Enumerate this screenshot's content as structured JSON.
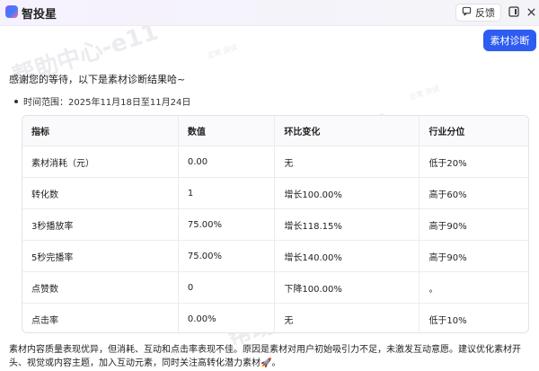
{
  "app": {
    "title": "智投星"
  },
  "header": {
    "feedback_label": "反馈"
  },
  "action": {
    "diagnose_label": "素材诊断"
  },
  "message": {
    "intro": "感谢您的等待，以下是素材诊断结果哈~",
    "time_range": "时间范围：2025年11月18日至11月24日",
    "summary": "素材内容质量表现优异，但消耗、互动和点击率表现不佳。原因是素材对用户初始吸引力不足，未激发互动意愿。建议优化素材开头、视觉或内容主题，加入互动元素，同时关注高转化潜力素材🚀。"
  },
  "table": {
    "headers": [
      "指标",
      "数值",
      "环比变化",
      "行业分位"
    ],
    "rows": [
      [
        "素材消耗（元）",
        "0.00",
        "无",
        "低于20%"
      ],
      [
        "转化数",
        "1",
        "增长100.00%",
        "高于60%"
      ],
      [
        "3秒播放率",
        "75.00%",
        "增长118.15%",
        "高于90%"
      ],
      [
        "5秒完播率",
        "75.00%",
        "增长140.00%",
        "高于90%"
      ],
      [
        "点赞数",
        "0",
        "下降100.00%",
        "。"
      ],
      [
        "点击率",
        "0.00%",
        "无",
        "低于10%"
      ]
    ]
  },
  "watermark": {
    "text": "帮助中心-e11",
    "small_text": "正常 测试"
  },
  "icons": {
    "logo": "app-logo-icon",
    "feedback": "feedback-icon",
    "expand": "expand-icon",
    "close": "close-icon"
  }
}
